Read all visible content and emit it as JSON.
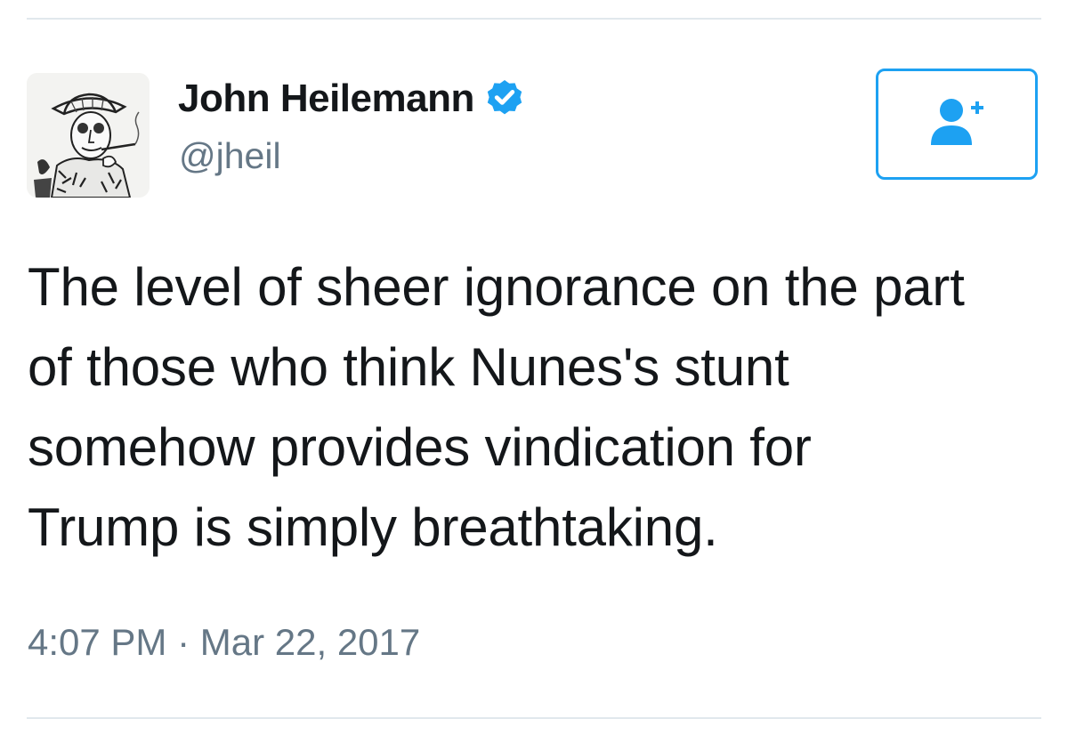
{
  "user": {
    "display_name": "John Heilemann",
    "handle": "@jheil",
    "verified": true,
    "avatar_icon": "sketch-portrait-avatar"
  },
  "follow_button": {
    "icon": "add-user-icon",
    "accent_color": "#1da1f2"
  },
  "tweet": {
    "text_lines": [
      "The level of sheer ignorance on the part",
      "of those who think Nunes's stunt",
      "somehow provides vindication for",
      "Trump is simply breathtaking."
    ],
    "time": "4:07 PM",
    "separator": "·",
    "date": "Mar 22, 2017"
  },
  "colors": {
    "text": "#14171a",
    "secondary": "#657786",
    "divider": "#e1e8ed",
    "verified": "#1da1f2"
  }
}
